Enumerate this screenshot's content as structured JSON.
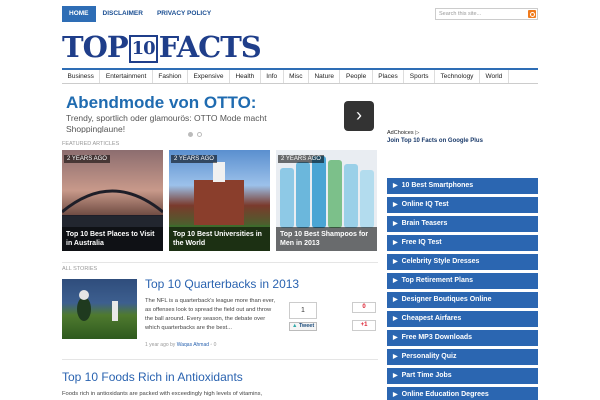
{
  "topnav": {
    "items": [
      {
        "label": "HOME",
        "active": true
      },
      {
        "label": "DISCLAIMER",
        "active": false
      },
      {
        "label": "PRIVACY POLICY",
        "active": false
      }
    ],
    "search_placeholder": "Search this site..."
  },
  "logo": {
    "part1": "TOP",
    "part2": "10",
    "part3": "FACTS"
  },
  "categories": [
    "Business",
    "Entertainment",
    "Fashion",
    "Expensive",
    "Health",
    "Info",
    "Misc",
    "Nature",
    "People",
    "Places",
    "Sports",
    "Technology",
    "World"
  ],
  "ad": {
    "title": "Abendmode von OTTO:",
    "text": "Trendy, sportlich oder glamourös: OTTO Mode macht Shoppinglaune!",
    "arrow": "›"
  },
  "featured": {
    "label": "FEATURED ARTICLES",
    "tiles": [
      {
        "age": "2 YEARS AGO",
        "caption": "Top 10 Best Places to Visit in Australia"
      },
      {
        "age": "2 YEARS AGO",
        "caption": "Top 10 Best Universities in the World"
      },
      {
        "age": "2 YEARS AGO",
        "caption": "Top 10 Best Shampoos for Men in 2013"
      }
    ]
  },
  "stories": {
    "label": "ALL STORIES",
    "article1": {
      "title": "Top 10 Quarterbacks in 2013",
      "text": "The NFL is a quarterback's league more than ever, as offenses look to spread the field out and throw the ball around. Every season, the debate over which quarterbacks are the best...",
      "meta_prefix": "1 year ago by",
      "author": "Waqas Ahmad",
      "comments": "0",
      "tweet_count": "1",
      "tweet_label": "Tweet",
      "gplus_count": "0",
      "gplus_label": "+1"
    },
    "article2": {
      "title": "Top 10 Foods Rich in Antioxidants",
      "text": "Foods rich in antioxidants are packed with exceedingly high levels of vitamins,"
    }
  },
  "sidebar": {
    "adchoices": "AdChoices ▷",
    "gplus_link": "Join Top 10 Facts on Google Plus",
    "links": [
      "10 Best Smartphones",
      "Online IQ Test",
      "Brain Teasers",
      "Free IQ Test",
      "Celebrity Style Dresses",
      "Top Retirement Plans",
      "Designer Boutiques Online",
      "Cheapest Airfares",
      "Free MP3 Downloads",
      "Personality Quiz",
      "Part Time Jobs",
      "Online Education Degrees"
    ]
  }
}
